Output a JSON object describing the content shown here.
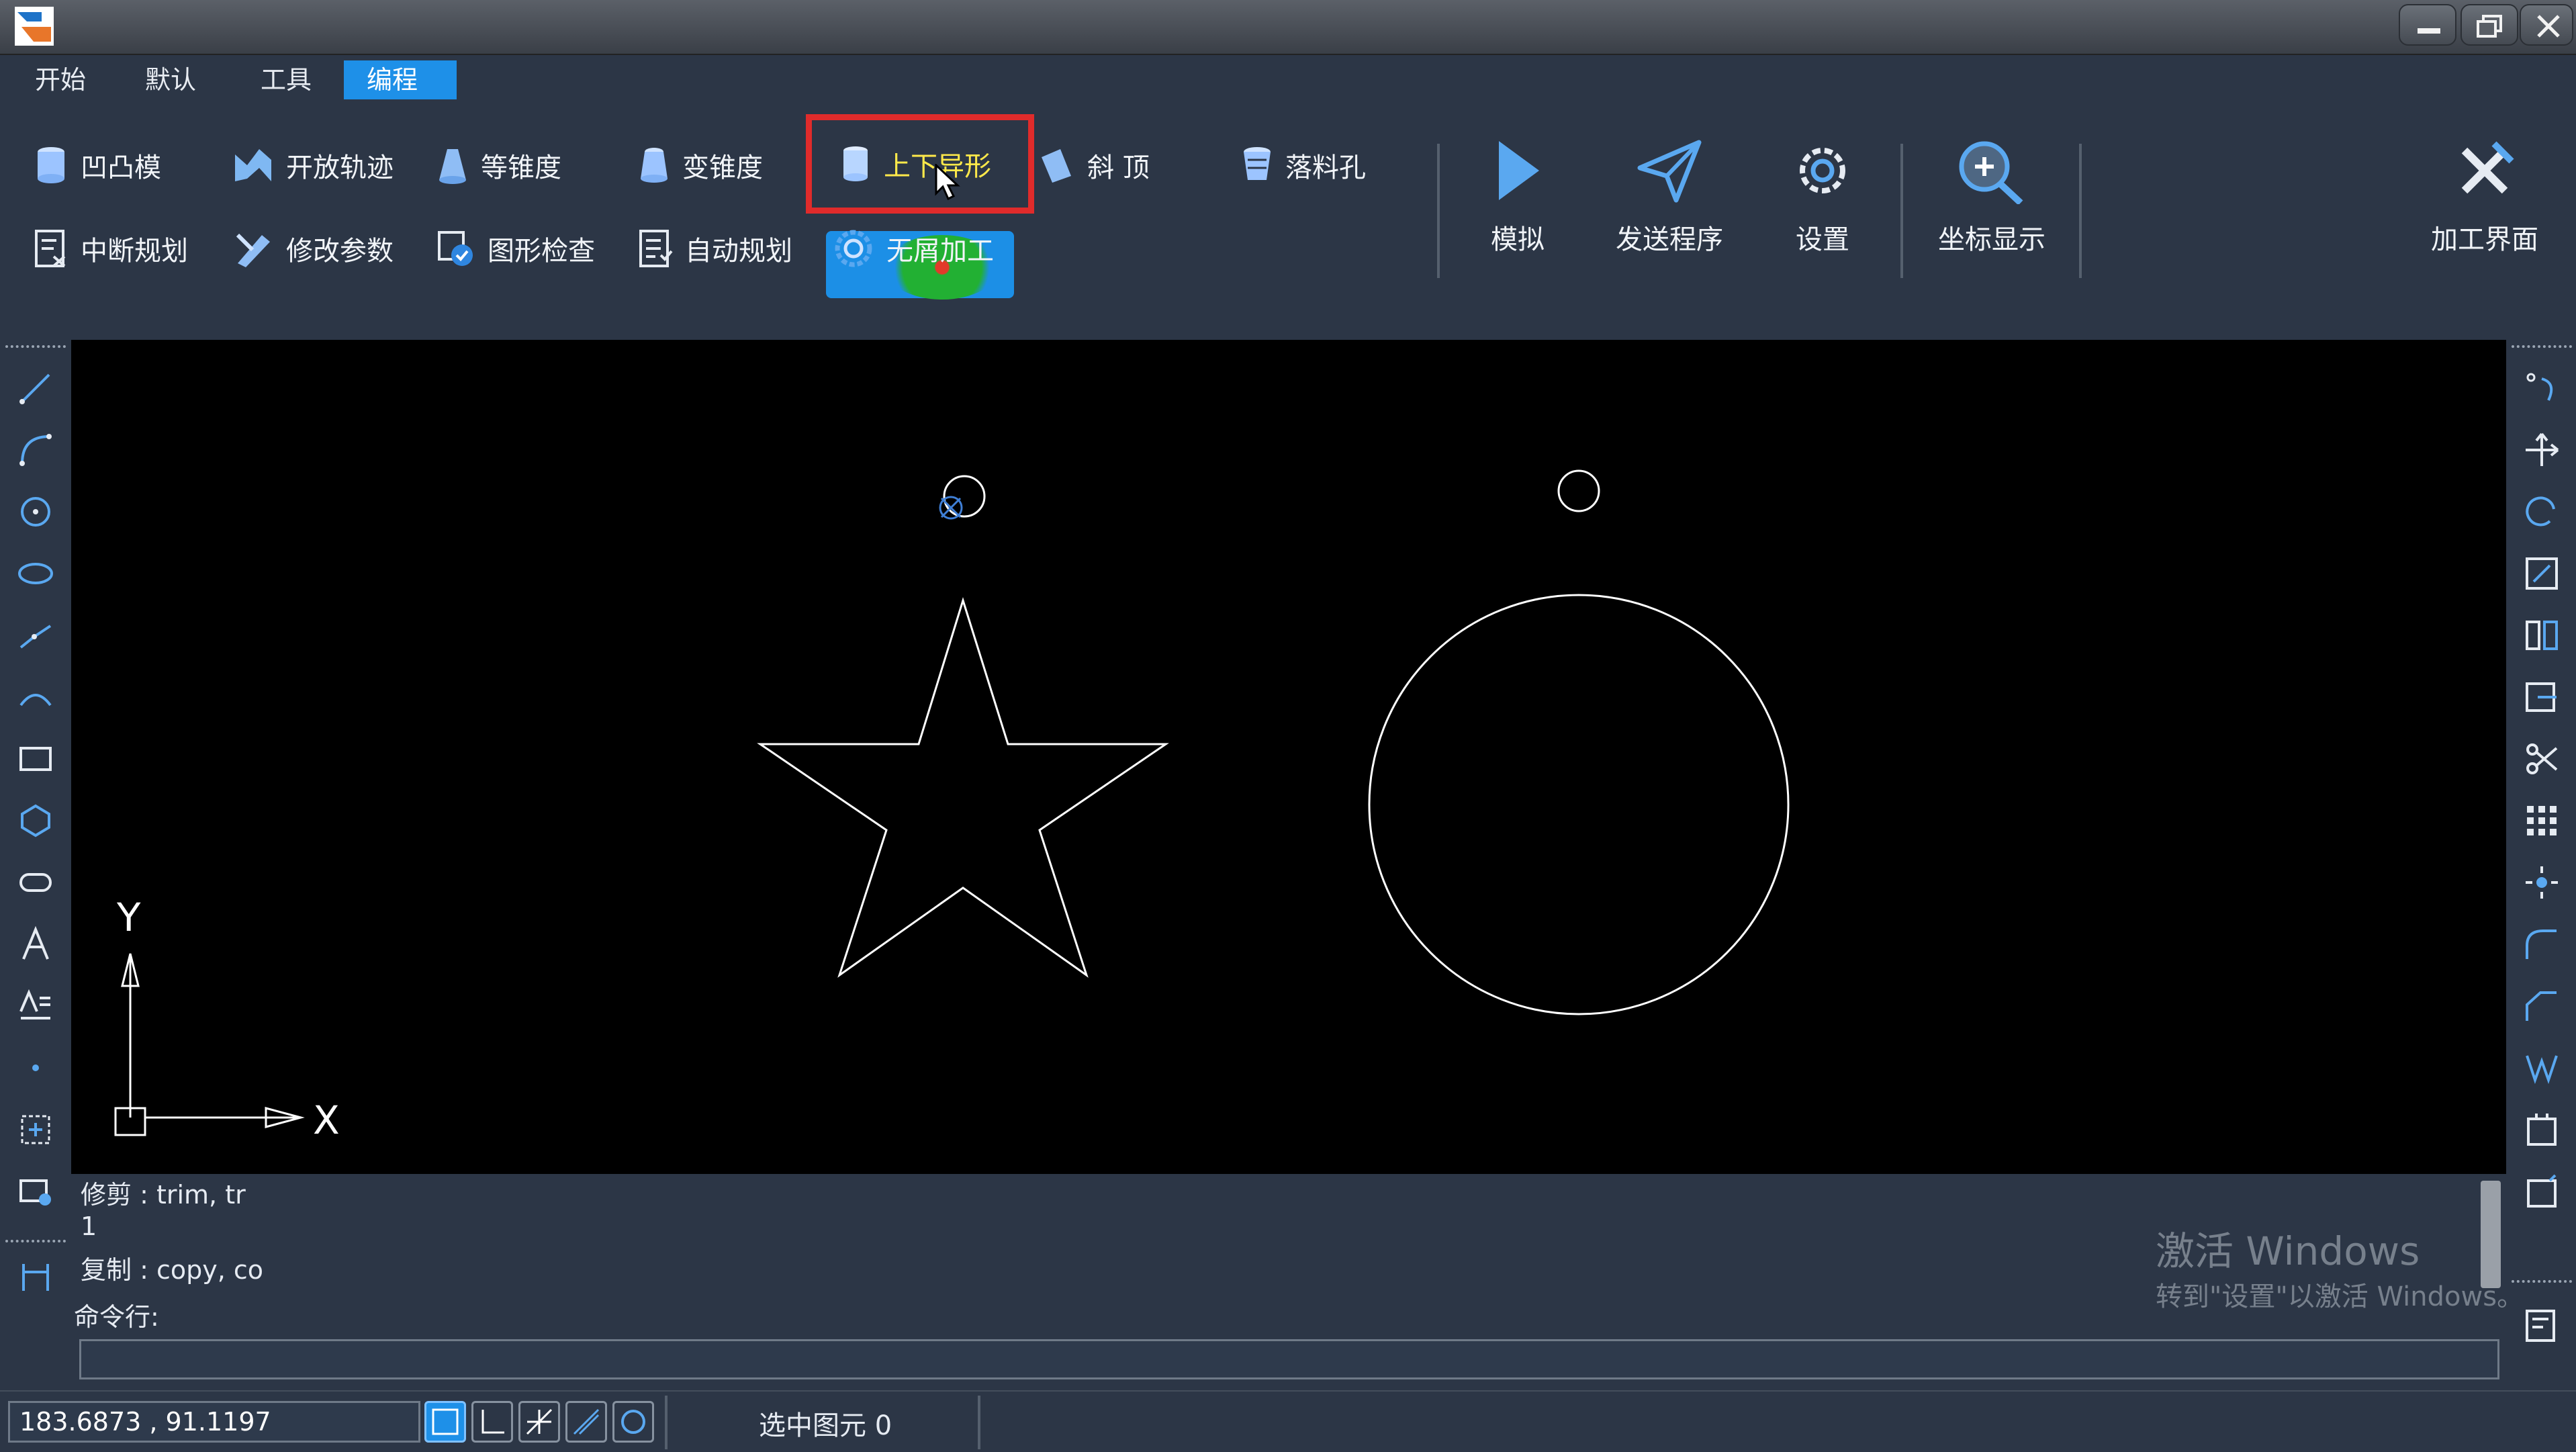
{
  "menu": [
    {
      "label": "开始",
      "active": false
    },
    {
      "label": "默认",
      "active": false
    },
    {
      "label": "工具",
      "active": false
    },
    {
      "label": "编程",
      "active": true
    }
  ],
  "ribbon": {
    "row1": [
      "凹凸模",
      "开放轨迹",
      "等锥度",
      "变锥度",
      "上下异形",
      "斜 顶",
      "落料孔"
    ],
    "row2": [
      "中断规划",
      "修改参数",
      "图形检查",
      "自动规划",
      "无屑加工"
    ],
    "big": [
      "模拟",
      "发送程序",
      "设置",
      "坐标显示",
      "加工界面"
    ]
  },
  "canvas": {
    "x_axis_label": "X",
    "y_axis_label": "Y"
  },
  "command": {
    "history": [
      "修剪 : trim, tr",
      "1",
      "复制 : copy, co"
    ],
    "prompt": "命令行:",
    "input_value": ""
  },
  "watermark": {
    "line1": "激活 Windows",
    "line2": "转到\"设置\"以激活 Windows。"
  },
  "status": {
    "coordinates": "183.6873 , 91.1197",
    "selected": "选中图元 0"
  },
  "colors": {
    "accent": "#1e90e8",
    "highlight": "#e02b2b",
    "background": "#2c3646"
  }
}
